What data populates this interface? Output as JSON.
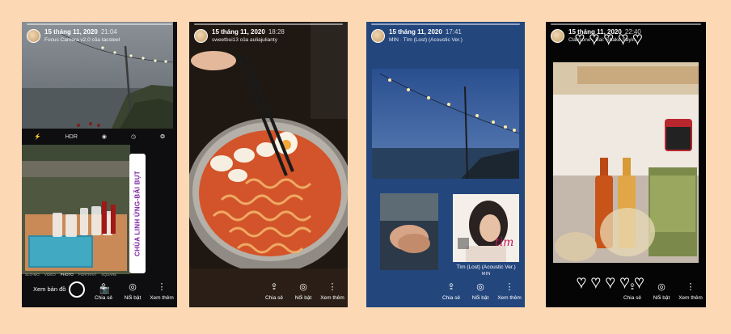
{
  "stories": [
    {
      "date": "15 tháng 11, 2020",
      "time": "21:04",
      "subtitle": "Focus Camera v2.0 của tacsteel",
      "camera_bar": [
        "HDR"
      ],
      "modes": [
        "SLO-MO",
        "VIDEO",
        "PHOTO",
        "PORTRAIT",
        "SQUARE"
      ],
      "map_label": "Xem bản đồ",
      "sticker": "CHÙA LINH ỨNG-BÃI BỤT",
      "actions": [
        "Chia sẻ",
        "Nổi bật",
        "Xem thêm"
      ]
    },
    {
      "date": "15 tháng 11, 2020",
      "time": "18:28",
      "subtitle": "sweetbui13 của auliajulianty",
      "actions": [
        "Chia sẻ",
        "Nổi bật",
        "Xem thêm"
      ]
    },
    {
      "date": "15 tháng 11, 2020",
      "time": "17:41",
      "subtitle": "MIN · Tìm (Lost) (Acoustic Ver.)",
      "music_title": "Tìm (Lost) (Acoustic Ver.)",
      "music_artist": "MIN",
      "album_text": "tìm",
      "actions": [
        "Chia sẻ",
        "Nổi bật",
        "Xem thêm"
      ]
    },
    {
      "date": "15 tháng 11, 2020",
      "time": "22:40",
      "subtitle": "Clairsone - Bai: Shake Sayin",
      "actions": [
        "Chia sẻ",
        "Nổi bật",
        "Xem thêm"
      ]
    }
  ],
  "icons": {
    "share": "share-icon",
    "highlight": "highlight-icon",
    "more": "more-icon",
    "heart": "heart-icon"
  },
  "colors": {
    "background": "#fdd8b4",
    "sticker_text": "#7a1fa2",
    "music_story_bg": "#23467d"
  }
}
